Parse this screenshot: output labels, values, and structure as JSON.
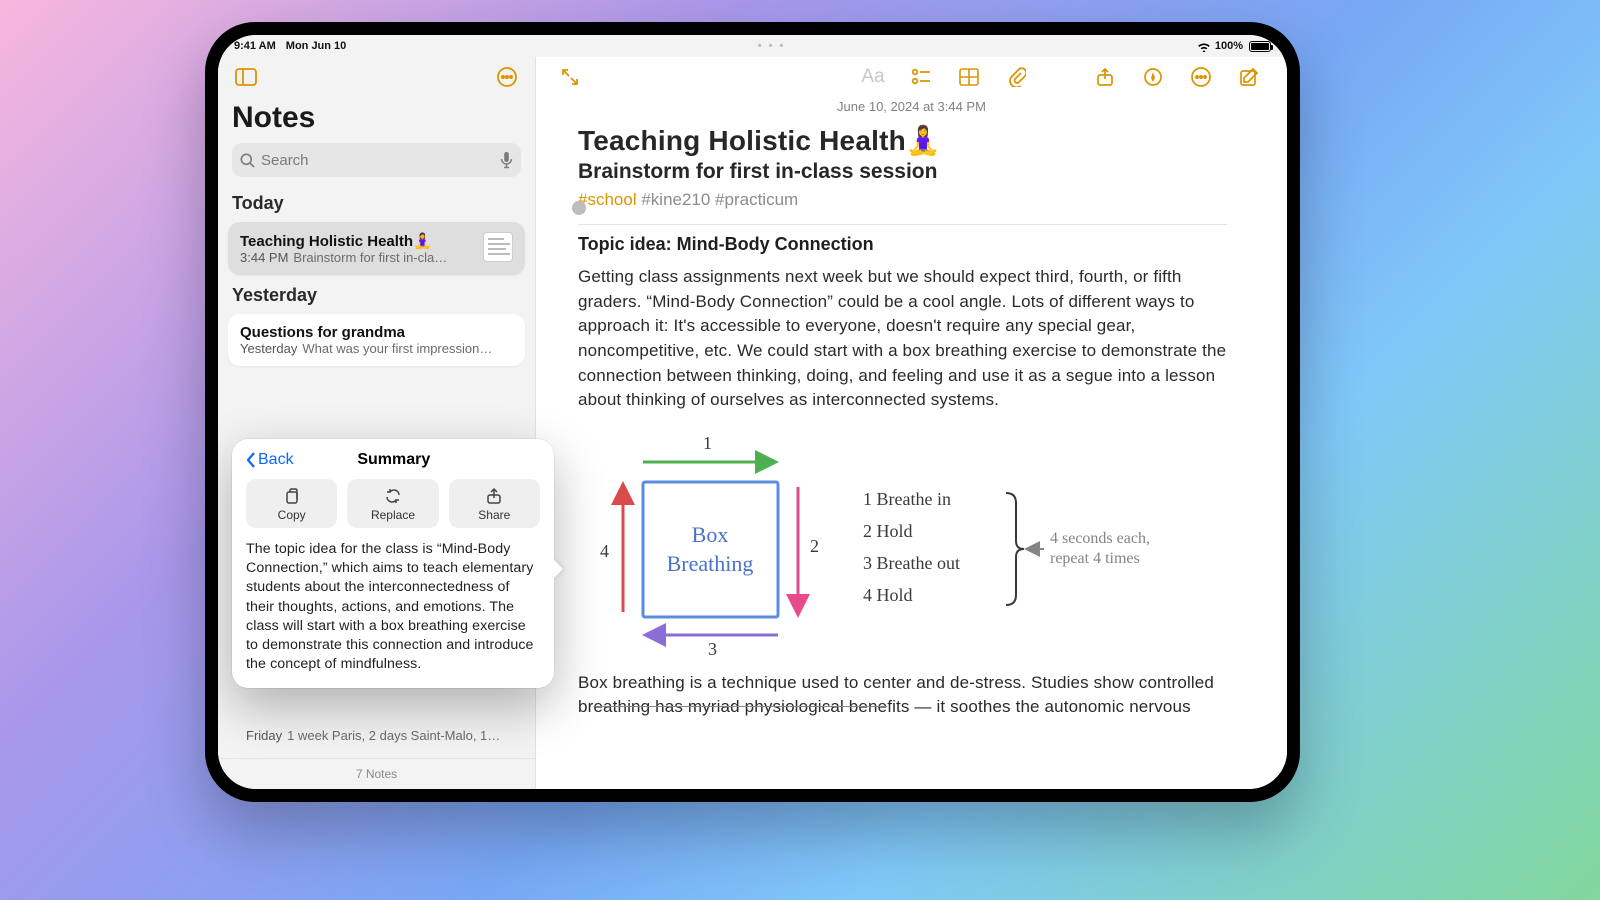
{
  "status": {
    "time": "9:41 AM",
    "date": "Mon Jun 10",
    "battery": "100%"
  },
  "sidebar": {
    "title": "Notes",
    "search_placeholder": "Search",
    "sections": {
      "today": "Today",
      "yesterday": "Yesterday"
    },
    "today_note": {
      "title": "Teaching Holistic Health🧘‍♀️",
      "time": "3:44 PM",
      "preview": "Brainstorm for first in-cla…"
    },
    "yesterday_note": {
      "title": "Questions for grandma",
      "time": "Yesterday",
      "preview": "What was your first impression…"
    },
    "trip_note": {
      "time": "Friday",
      "preview": "1 week Paris, 2 days Saint-Malo, 1…"
    },
    "footer": "7 Notes"
  },
  "popover": {
    "back": "Back",
    "title": "Summary",
    "buttons": {
      "copy": "Copy",
      "replace": "Replace",
      "share": "Share"
    },
    "body": "The topic idea for the class is “Mind-Body Connection,” which aims to teach elementary students about the interconnectedness of their thoughts, actions, and emotions. The class will start with a box breathing exercise to demonstrate this connection and introduce the concept of mindfulness."
  },
  "content": {
    "date": "June 10, 2024 at 3:44 PM",
    "h1": "Teaching Holistic Health🧘‍♀️",
    "h2": "Brainstorm for first in-class session",
    "tag_school": "#school",
    "tag_rest": " #kine210 #practicum",
    "topic": "Topic idea: Mind-Body Connection",
    "para": "Getting class assignments next week but we should expect third, fourth, or fifth graders. “Mind-Body Connection” could be a cool angle. Lots of different ways to approach it: It's accessible to everyone, doesn't require any special gear, noncompetitive, etc. We could start with a box breathing exercise to demonstrate the connection between thinking, doing, and feeling and use it as a segue into a lesson about thinking of ourselves as interconnected systems.",
    "sketch": {
      "box_top": "Box",
      "box_bot": "Breathing",
      "n1": "1",
      "n2": "2",
      "n3": "3",
      "n4": "4",
      "s1": "1  Breathe in",
      "s2": "2  Hold",
      "s3": "3  Breathe out",
      "s4": "4  Hold",
      "note1": "4 seconds each,",
      "note2": "repeat 4 times"
    },
    "para2a": "Box breathing is a technique used to center and de-stress. Studies show controlled br",
    "para2_strike": "eathing has myriad physiological bene",
    "para2b": "fits — it soothes the autonomic nervous"
  }
}
